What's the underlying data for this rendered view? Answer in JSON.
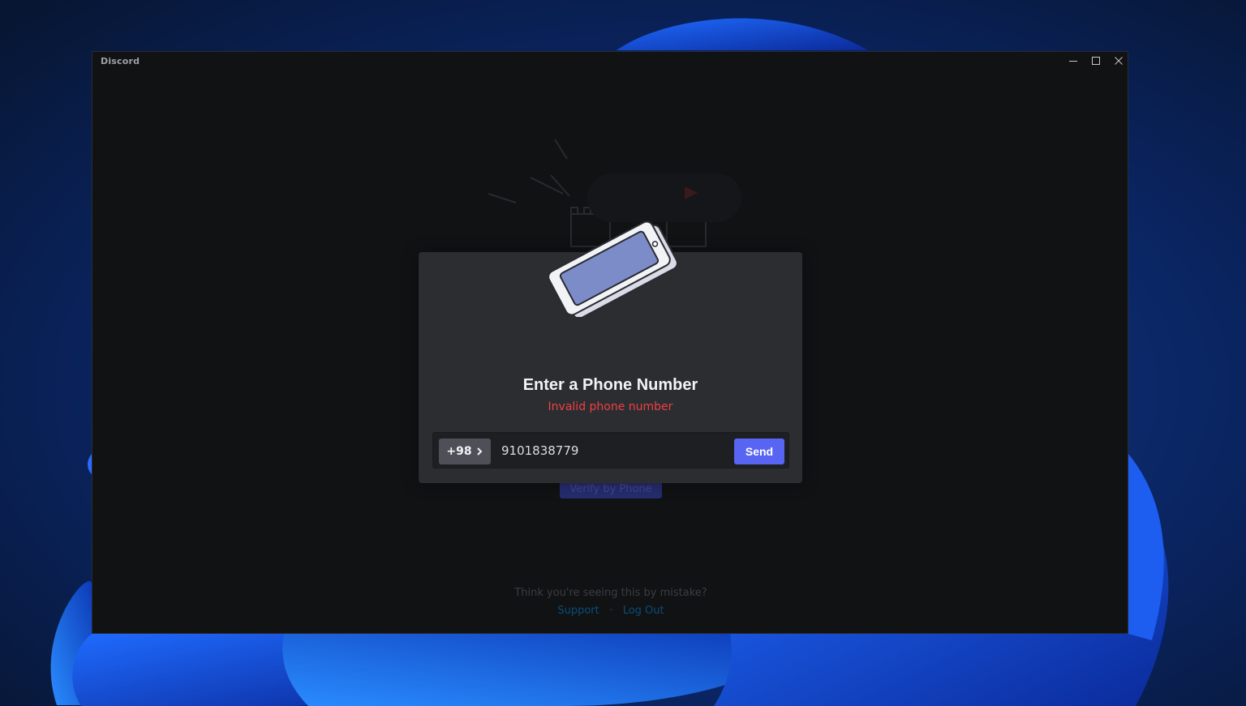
{
  "window": {
    "app_name": "Discord",
    "controls": {
      "minimize": "minimize-icon",
      "maximize": "maximize-icon",
      "close": "close-icon"
    }
  },
  "background_page": {
    "verify_button_label": "Verify by Phone",
    "mistake_text": "Think you're seeing this by mistake?",
    "support_link": "Support",
    "separator": "·",
    "logout_link": "Log Out"
  },
  "modal": {
    "title": "Enter a Phone Number",
    "error": "Invalid phone number",
    "country_code": "+98",
    "phone_value": "9101838779",
    "send_label": "Send"
  },
  "colors": {
    "accent": "#5865f2",
    "error": "#f23f43",
    "modal_bg": "#2b2d31",
    "window_bg": "#111214"
  }
}
